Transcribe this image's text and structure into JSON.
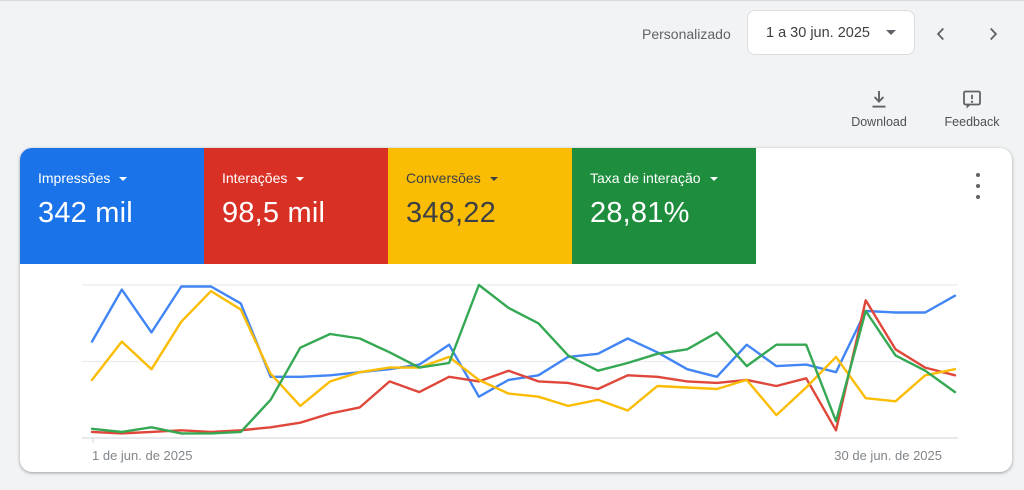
{
  "header": {
    "custom_label": "Personalizado",
    "date_range": "1 a 30 jun. 2025",
    "download_label": "Download",
    "feedback_label": "Feedback"
  },
  "scorecards": [
    {
      "label": "Impressões",
      "value": "342 mil",
      "color": "#1a73e8",
      "text_color": "#ffffff"
    },
    {
      "label": "Interações",
      "value": "98,5 mil",
      "color": "#d93025",
      "text_color": "#ffffff"
    },
    {
      "label": "Conversões",
      "value": "348,22",
      "color": "#fbbc04",
      "text_color": "#3c4043"
    },
    {
      "label": "Taxa de interação",
      "value": "28,81%",
      "color": "#1e8e3e",
      "text_color": "#ffffff"
    }
  ],
  "chart_data": {
    "type": "line",
    "title": "",
    "xlabel": "",
    "ylabel": "",
    "x_axis": {
      "start_label": "1 de jun. de 2025",
      "end_label": "30 de jun. de 2025",
      "points": 30
    },
    "ylim": [
      0,
      100
    ],
    "value_scale": "percent of plot height (no y-axis labels shown in chart)",
    "grid": "horizontal, 3 lines (top, middle, bottom axis)",
    "legend": "none (colors match scorecards)",
    "series": [
      {
        "name": "Impressões",
        "color": "#4285f4",
        "values": [
          63,
          97,
          69,
          99,
          99,
          88,
          40,
          40,
          41,
          43,
          45,
          48,
          61,
          27,
          38,
          41,
          53,
          55,
          65,
          56,
          45,
          40,
          61,
          47,
          48,
          43,
          83,
          82,
          82,
          93
        ]
      },
      {
        "name": "Interações",
        "color": "#e0473b",
        "values": [
          4,
          3,
          4,
          5,
          4,
          5,
          7,
          10,
          16,
          20,
          37,
          30,
          40,
          37,
          44,
          37,
          36,
          32,
          41,
          40,
          37,
          36,
          38,
          34,
          39,
          5,
          90,
          58,
          46,
          41
        ]
      },
      {
        "name": "Conversões",
        "color": "#fbbc04",
        "values": [
          38,
          63,
          45,
          76,
          96,
          84,
          42,
          21,
          37,
          43,
          46,
          46,
          53,
          38,
          29,
          27,
          21,
          25,
          18,
          34,
          33,
          32,
          38,
          15,
          33,
          53,
          26,
          24,
          41,
          45
        ]
      },
      {
        "name": "Taxa de interação",
        "color": "#34a853",
        "values": [
          6,
          4,
          7,
          3,
          3,
          4,
          25,
          59,
          68,
          65,
          56,
          46,
          49,
          100,
          85,
          75,
          54,
          44,
          49,
          55,
          58,
          69,
          47,
          61,
          61,
          11,
          83,
          54,
          44,
          30
        ]
      }
    ]
  }
}
